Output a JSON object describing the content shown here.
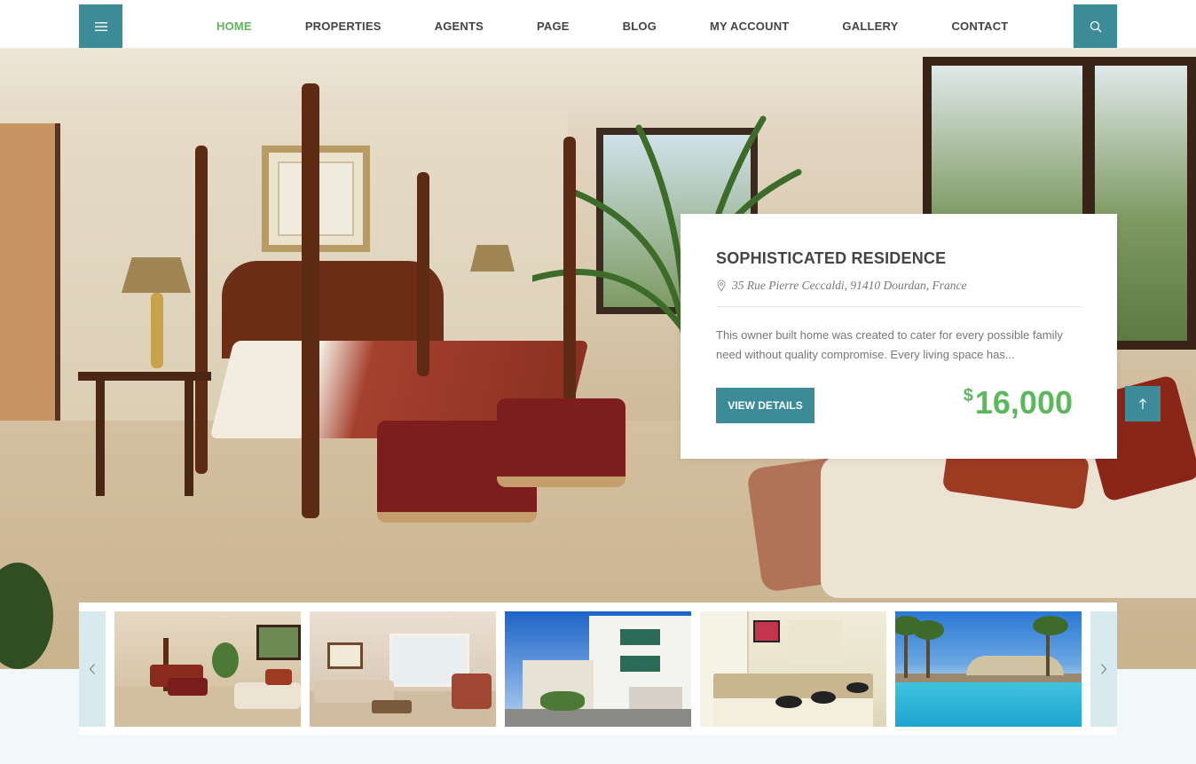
{
  "nav": {
    "menu_icon": "hamburger-icon",
    "search_icon": "search-icon",
    "links": [
      {
        "label": "HOME",
        "active": true
      },
      {
        "label": "PROPERTIES",
        "active": false
      },
      {
        "label": "AGENTS",
        "active": false
      },
      {
        "label": "PAGE",
        "active": false
      },
      {
        "label": "BLOG",
        "active": false
      },
      {
        "label": "MY ACCOUNT",
        "active": false
      },
      {
        "label": "GALLERY",
        "active": false
      },
      {
        "label": "CONTACT",
        "active": false
      }
    ]
  },
  "property": {
    "title": "SOPHISTICATED RESIDENCE",
    "address": "35 Rue Pierre Ceccaldi, 91410 Dourdan, France",
    "description": "This owner built home was created to cater for every possible family need without quality compromise. Every living space has...",
    "button_label": "VIEW DETAILS",
    "currency": "$",
    "price": "16,000"
  },
  "gallery": {
    "prev_icon": "chevron-left-icon",
    "next_icon": "chevron-right-icon",
    "thumbnails": [
      "bedroom",
      "living-room",
      "house-exterior",
      "kitchen",
      "pool"
    ]
  },
  "colors": {
    "accent": "#3b8b98",
    "active_nav": "#5cb85c",
    "price": "#5cb85c"
  }
}
